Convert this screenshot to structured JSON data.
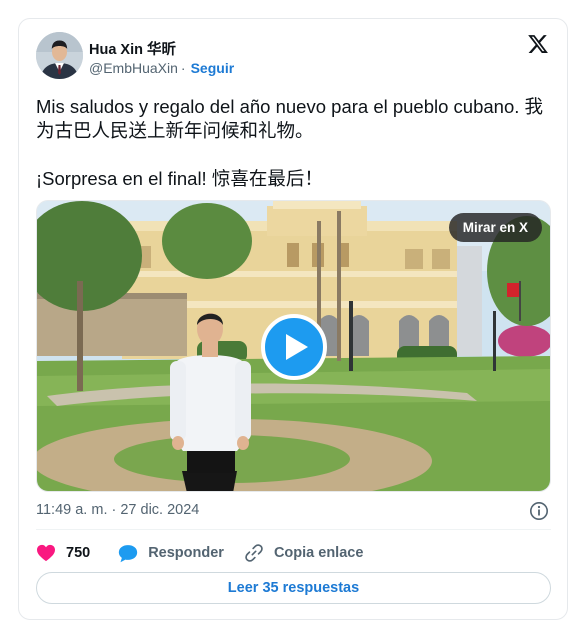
{
  "author": {
    "name": "Hua Xin 华昕",
    "handle": "@EmbHuaXin",
    "separator": "·",
    "follow_label": "Seguir"
  },
  "icons": {
    "platform": "x-logo-icon",
    "play": "play-icon",
    "info": "info-circle-icon",
    "like": "heart-icon",
    "reply": "speech-bubble-icon",
    "copy": "link-icon"
  },
  "tweet": {
    "text_line1": "Mis saludos y regalo del año nuevo para el pueblo cubano. 我为古巴人民送上新年问候和礼物。",
    "text_line2": "¡Sorpresa en el final! 惊喜在最后！"
  },
  "media": {
    "watch_label": "Mirar en X"
  },
  "meta": {
    "timestamp": "11:49 a. m. · 27 dic. 2024"
  },
  "actions": {
    "like_count": "750",
    "reply_label": "Responder",
    "copy_label": "Copia enlace"
  },
  "footer": {
    "read_replies_label": "Leer 35 respuestas"
  },
  "colors": {
    "accent": "#1d9bf0",
    "link": "#1d7ad4",
    "like": "#f91880",
    "text": "#0f1419",
    "muted": "#536471"
  }
}
